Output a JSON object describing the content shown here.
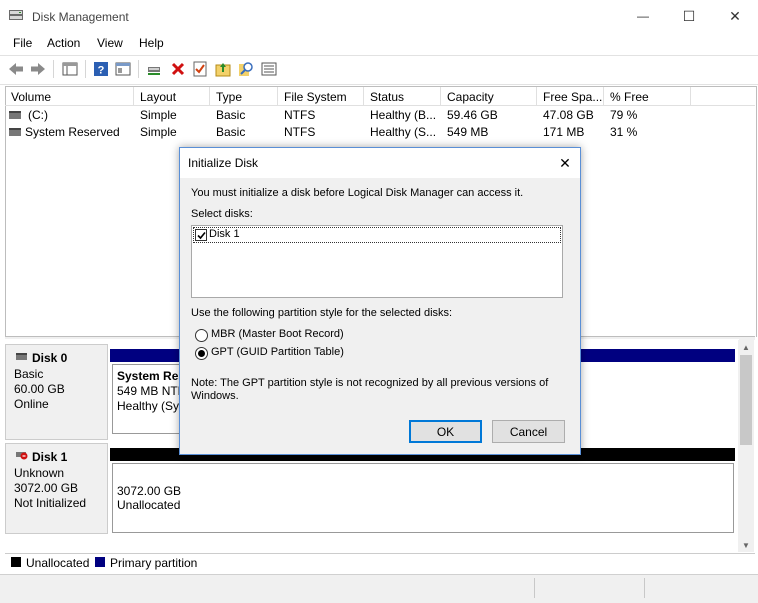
{
  "window": {
    "title": "Disk Management",
    "minimize": "—",
    "maximize": "☐",
    "close": "✕"
  },
  "menu": [
    "File",
    "Action",
    "View",
    "Help"
  ],
  "volume_table": {
    "columns": [
      "Volume",
      "Layout",
      "Type",
      "File System",
      "Status",
      "Capacity",
      "Free Spa...",
      "% Free"
    ],
    "rows": [
      [
        "(C:)",
        "Simple",
        "Basic",
        "NTFS",
        "Healthy (B...",
        "59.46 GB",
        "47.08 GB",
        "79 %"
      ],
      [
        "System Reserved",
        "Simple",
        "Basic",
        "NTFS",
        "Healthy (S...",
        "549 MB",
        "171 MB",
        "31 %"
      ]
    ]
  },
  "disks": [
    {
      "name": "Disk 0",
      "type": "Basic",
      "size": "60.00 GB",
      "status": "Online",
      "partition_title": "System Res",
      "partition_line1": "549 MB NTF",
      "partition_line2": "Healthy (Sys"
    },
    {
      "name": "Disk 1",
      "type": "Unknown",
      "size": "3072.00 GB",
      "status": "Not Initialized",
      "partition_line1": "3072.00 GB",
      "partition_line2": "Unallocated"
    }
  ],
  "legend": {
    "unallocated": "Unallocated",
    "primary": "Primary partition",
    "unallocated_color": "#000000",
    "primary_color": "#000080"
  },
  "dialog": {
    "title": "Initialize Disk",
    "close": "✕",
    "intro": "You must initialize a disk before Logical Disk Manager can access it.",
    "select_label": "Select disks:",
    "disk_item": "Disk 1",
    "disk_item_checked": true,
    "style_label": "Use the following partition style for the selected disks:",
    "option_mbr": "MBR (Master Boot Record)",
    "option_gpt": "GPT (GUID Partition Table)",
    "selected_option": "GPT",
    "note_line1": "Note: The GPT partition style is not recognized by all previous versions of",
    "note_line2": "Windows.",
    "ok": "OK",
    "cancel": "Cancel"
  },
  "colors": {
    "accent": "#0078d7",
    "dialog_border": "#5a8fd6",
    "partition_header": "#000080",
    "unallocated_header": "#000000"
  }
}
